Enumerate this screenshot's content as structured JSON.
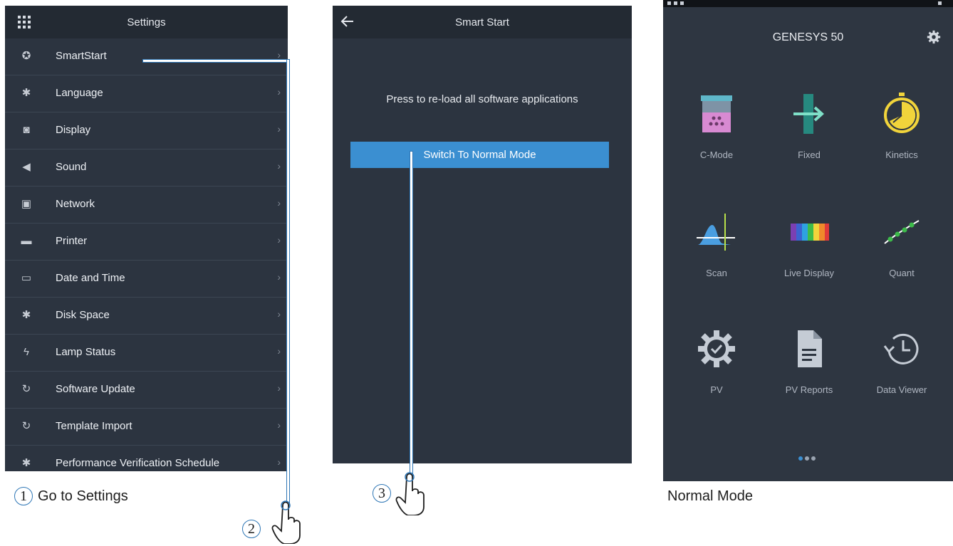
{
  "settings": {
    "title": "Settings",
    "items": [
      {
        "label": "SmartStart",
        "icon": "star-badge-icon"
      },
      {
        "label": "Language",
        "icon": "gear-icon"
      },
      {
        "label": "Display",
        "icon": "display-icon"
      },
      {
        "label": "Sound",
        "icon": "speaker-icon"
      },
      {
        "label": "Network",
        "icon": "network-icon"
      },
      {
        "label": "Printer",
        "icon": "printer-icon"
      },
      {
        "label": "Date and Time",
        "icon": "calendar-icon"
      },
      {
        "label": "Disk Space",
        "icon": "gear-icon"
      },
      {
        "label": "Lamp Status",
        "icon": "lightning-icon"
      },
      {
        "label": "Software Update",
        "icon": "refresh-icon"
      },
      {
        "label": "Template Import",
        "icon": "refresh-icon"
      },
      {
        "label": "Performance Verification Schedule",
        "icon": "gear-icon"
      }
    ],
    "chevron": "›"
  },
  "smart_start": {
    "title": "Smart Start",
    "prompt": "Press to re-load all software applications",
    "button": "Switch To Normal Mode"
  },
  "home": {
    "title": "GENESYS 50",
    "apps": [
      {
        "label": "C-Mode",
        "icon": "beaker-icon"
      },
      {
        "label": "Fixed",
        "icon": "fixed-wavelength-icon"
      },
      {
        "label": "Kinetics",
        "icon": "stopwatch-icon"
      },
      {
        "label": "Scan",
        "icon": "scan-peak-icon"
      },
      {
        "label": "Live Display",
        "icon": "spectrum-icon"
      },
      {
        "label": "Quant",
        "icon": "curve-icon"
      },
      {
        "label": "PV",
        "icon": "gear-check-icon"
      },
      {
        "label": "PV Reports",
        "icon": "document-icon"
      },
      {
        "label": "Data Viewer",
        "icon": "history-icon"
      }
    ]
  },
  "annotations": {
    "step1_num": "1",
    "step1_text": "Go to Settings",
    "step2_num": "2",
    "step3_num": "3",
    "normal_mode": "Normal Mode"
  },
  "colors": {
    "accent": "#3b8fd1",
    "panel_bg": "#2c3440",
    "topbar_bg": "#232a33",
    "callout": "#2f77b6"
  }
}
